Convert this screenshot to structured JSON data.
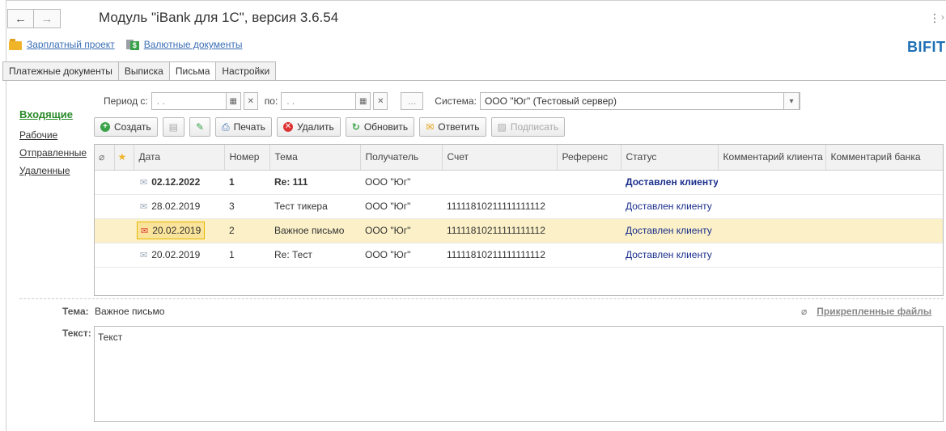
{
  "window": {
    "title": "Модуль \"iBank для 1С\", версия 3.6.54",
    "back": "←",
    "forward": "→",
    "more": "⋮",
    "more_arrow": "›"
  },
  "links": {
    "salary": "Зарплатный проект",
    "currency": "Валютные документы",
    "money_badge": "$"
  },
  "logo": "BIFIT",
  "tabs": [
    "Платежные документы",
    "Выписка",
    "Письма",
    "Настройки"
  ],
  "active_tab": "Письма",
  "folders": [
    "Входящие",
    "Рабочие",
    "Отправленные",
    "Удаленные"
  ],
  "filter": {
    "period_label": "Период с:",
    "from_value": ". .",
    "to_label": "по:",
    "to_value": ". .",
    "dots": "...",
    "system_label": "Система:",
    "system_value": "ООО \"Юг\" (Тестовый сервер)"
  },
  "toolbar": {
    "create": "Создать",
    "print": "Печать",
    "delete": "Удалить",
    "refresh": "Обновить",
    "reply": "Ответить",
    "sign": "Подписать"
  },
  "table": {
    "headers": [
      "Дата",
      "Номер",
      "Тема",
      "Получатель",
      "Счет",
      "Референс",
      "Статус",
      "Комментарий клиента",
      "Комментарий банка"
    ],
    "rows": [
      {
        "date": "02.12.2022",
        "number": "1",
        "subject": "Re: 111",
        "recipient": "ООО \"Юг\"",
        "account": "",
        "reference": "",
        "status": "Доставлен клиенту",
        "comment_client": "",
        "comment_bank": ""
      },
      {
        "date": "28.02.2019",
        "number": "3",
        "subject": "Тест тикера",
        "recipient": "ООО \"Юг\"",
        "account": "11111810211111111112",
        "reference": "",
        "status": "Доставлен клиенту",
        "comment_client": "",
        "comment_bank": ""
      },
      {
        "date": "20.02.2019",
        "number": "2",
        "subject": "Важное письмо",
        "recipient": "ООО \"Юг\"",
        "account": "11111810211111111112",
        "reference": "",
        "status": "Доставлен клиенту",
        "comment_client": "",
        "comment_bank": ""
      },
      {
        "date": "20.02.2019",
        "number": "1",
        "subject": "Re: Тест",
        "recipient": "ООО \"Юг\"",
        "account": "11111810211111111112",
        "reference": "",
        "status": "Доставлен клиенту",
        "comment_client": "",
        "comment_bank": ""
      }
    ]
  },
  "detail": {
    "subject_label": "Тема:",
    "subject_value": "Важное письмо",
    "attachments": "Прикрепленные файлы",
    "text_label": "Текст:",
    "text_value": "Текст"
  }
}
